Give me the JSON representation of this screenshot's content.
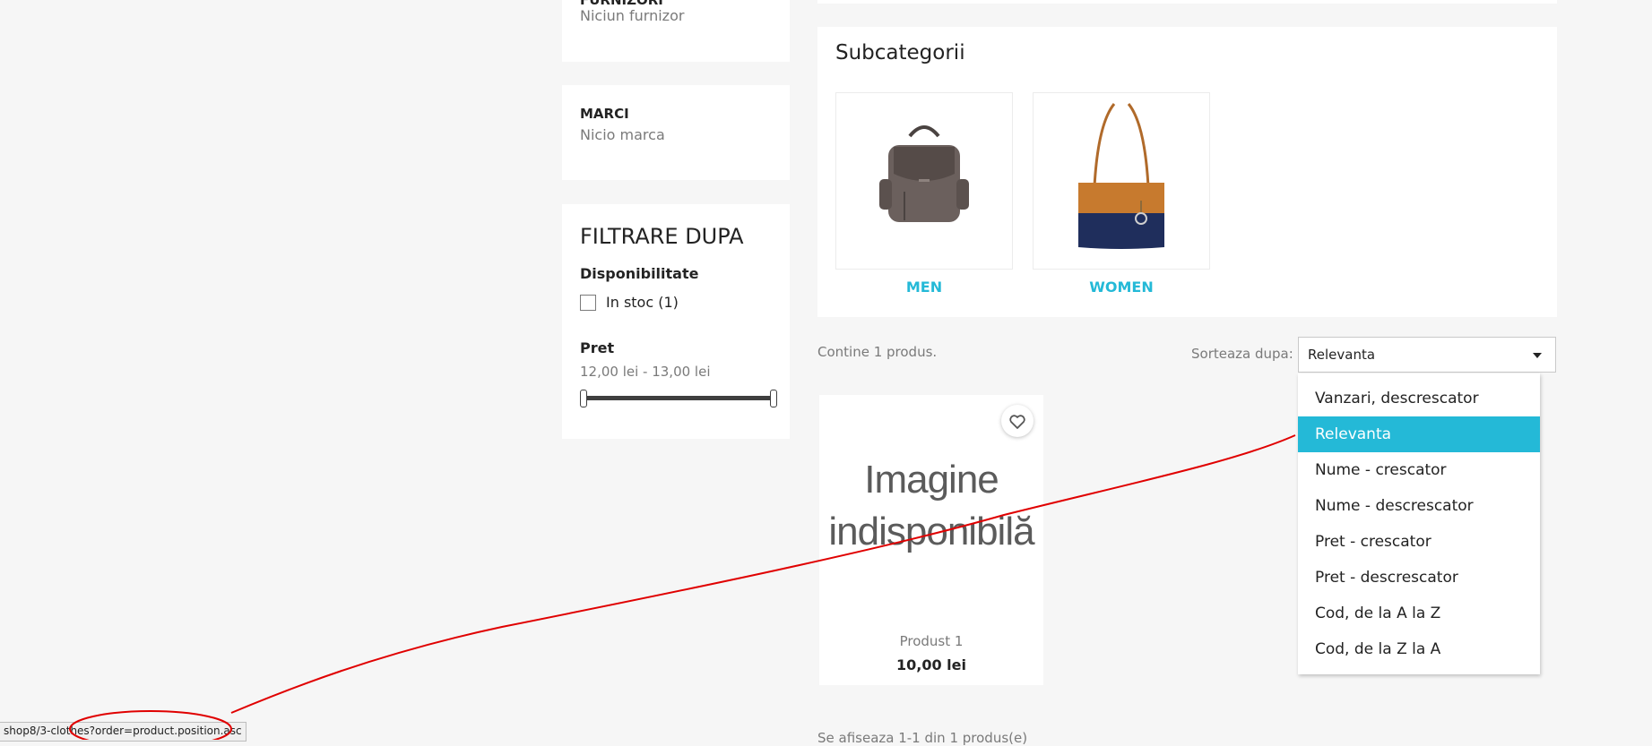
{
  "sidebar": {
    "suppliers": {
      "heading": "FURNIZORI",
      "value": "Niciun furnizor"
    },
    "brands": {
      "heading": "MARCI",
      "value": "Nicio marca"
    },
    "filters": {
      "title": "FILTRARE DUPA",
      "availability_heading": "Disponibilitate",
      "in_stock_label": "In stoc (1)",
      "price_heading": "Pret",
      "price_range": "12,00 lei - 13,00 lei"
    }
  },
  "subcategories": {
    "title": "Subcategorii",
    "items": [
      {
        "name": "MEN"
      },
      {
        "name": "WOMEN"
      }
    ]
  },
  "listing": {
    "count_text": "Contine 1 produs.",
    "sort_label": "Sorteaza dupa:",
    "sort_selected": "Relevanta",
    "sort_options": [
      "Vanzari, descrescator",
      "Relevanta",
      "Nume - crescator",
      "Nume - descrescator",
      "Pret - crescator",
      "Pret - descrescator",
      "Cod, de la A la Z",
      "Cod, de la Z la A"
    ],
    "active_option_index": 1,
    "pagination_text": "Se afiseaza 1-1 din 1 produs(e)"
  },
  "product": {
    "image_placeholder_line1": "Imagine",
    "image_placeholder_line2": "indisponibilă",
    "name": "Produst 1",
    "price": "10,00 lei"
  },
  "status_bar": {
    "url": "shop8/3-clothes?order=product.position.asc"
  },
  "colors": {
    "accent": "#24b9d7",
    "annotation": "#e00000"
  }
}
